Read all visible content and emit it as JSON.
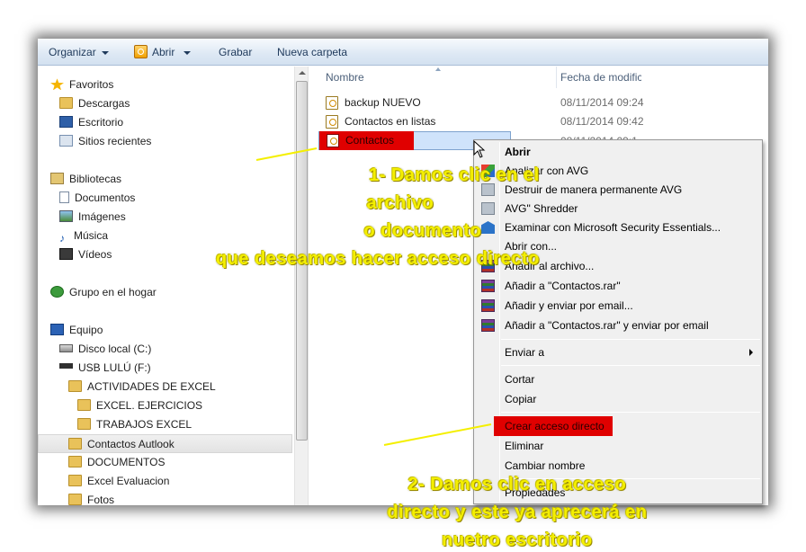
{
  "toolbar": {
    "organize_label": "Organizar",
    "open_label": "Abrir",
    "burn_label": "Grabar",
    "new_folder_label": "Nueva carpeta"
  },
  "nav": {
    "favorites": "Favoritos",
    "downloads": "Descargas",
    "desktop": "Escritorio",
    "recent": "Sitios recientes",
    "libraries": "Bibliotecas",
    "documents": "Documentos",
    "images": "Imágenes",
    "music": "Música",
    "videos": "Vídeos",
    "homegroup": "Grupo en el hogar",
    "computer": "Equipo",
    "local_disk": "Disco local (C:)",
    "usb": "USB LULÚ (F:)",
    "folders": [
      "ACTIVIDADES DE EXCEL",
      "EXCEL. EJERCICIOS",
      "TRABAJOS EXCEL",
      "Contactos Autlook",
      "DOCUMENTOS",
      "Excel Evaluacion",
      "Fotos"
    ]
  },
  "files": {
    "col_name": "Nombre",
    "col_date": "Fecha de modific",
    "rows": [
      {
        "name": "backup NUEVO",
        "date": "08/11/2014 09:24"
      },
      {
        "name": "Contactos en listas",
        "date": "08/11/2014 09:42"
      },
      {
        "name": "Contactos",
        "date": "08/11/2014 09:1"
      }
    ]
  },
  "context_menu": {
    "open": "Abrir",
    "avg_scan": "Analizar con AVG",
    "avg_destroy": "Destruir de manera permanente AVG",
    "avg_shredder": "AVG\" Shredder",
    "mse_scan": "Examinar con Microsoft Security Essentials...",
    "open_with": "Abrir con...",
    "add_archive": "Añadir al archivo...",
    "add_rar": "Añadir a \"Contactos.rar\"",
    "add_email": "Añadir y enviar por email...",
    "add_rar_email": "Añadir a \"Contactos.rar\" y enviar por email",
    "send_to": "Enviar a",
    "cut": "Cortar",
    "copy": "Copiar",
    "create_shortcut": "Crear acceso directo",
    "delete": "Eliminar",
    "rename": "Cambiar nombre",
    "properties": "Propiedades"
  },
  "annotations": {
    "step1_line1": "1- Damos clic en el",
    "step1_line2": "archivo",
    "step1_line3": "o documento",
    "step1_line4": "que deseamos hacer acceso directo",
    "step2_line1": "2- Damos clic en acceso",
    "step2_line2": "directo y este ya aprecerá en",
    "step2_line3": "nuetro escritorio"
  },
  "colors": {
    "highlight_red": "#e00000",
    "annotation_yellow": "#f4ef00",
    "selection_blue": "#cfe3fb",
    "toolbar_text": "#1e395b"
  }
}
